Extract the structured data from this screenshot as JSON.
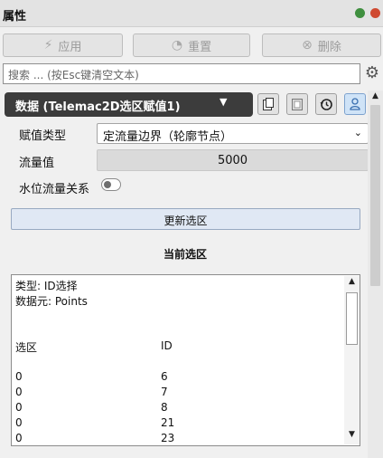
{
  "panel": {
    "title": "属性"
  },
  "toolbar": {
    "apply": "应用",
    "reset": "重置",
    "delete": "删除"
  },
  "search": {
    "placeholder": "搜索 ... (按Esc键清空文本)"
  },
  "section": {
    "title": "数据 (Telemac2D选区赋值1)",
    "buttons": [
      "copy-icon",
      "paste-icon",
      "history-icon",
      "user-icon"
    ]
  },
  "form": {
    "assign_type_label": "赋值类型",
    "assign_type_value": "定流量边界（轮廓节点）",
    "flow_label": "流量值",
    "flow_value": "5000",
    "stage_flow_label": "水位流量关系",
    "stage_flow_on": false
  },
  "update_button": "更新选区",
  "current_selection": {
    "title": "当前选区",
    "type_line": "类型: ID选择",
    "element_line": "数据元: Points",
    "col_selection": "选区",
    "col_id": "ID",
    "rows": [
      {
        "selection": "0",
        "id": "6"
      },
      {
        "selection": "0",
        "id": "7"
      },
      {
        "selection": "0",
        "id": "8"
      },
      {
        "selection": "0",
        "id": "21"
      },
      {
        "selection": "0",
        "id": "23"
      }
    ]
  },
  "colors": {
    "dark_header": "#3c3c3c",
    "green_dot": "#3f8f3f",
    "red_dot": "#cf4a31"
  }
}
